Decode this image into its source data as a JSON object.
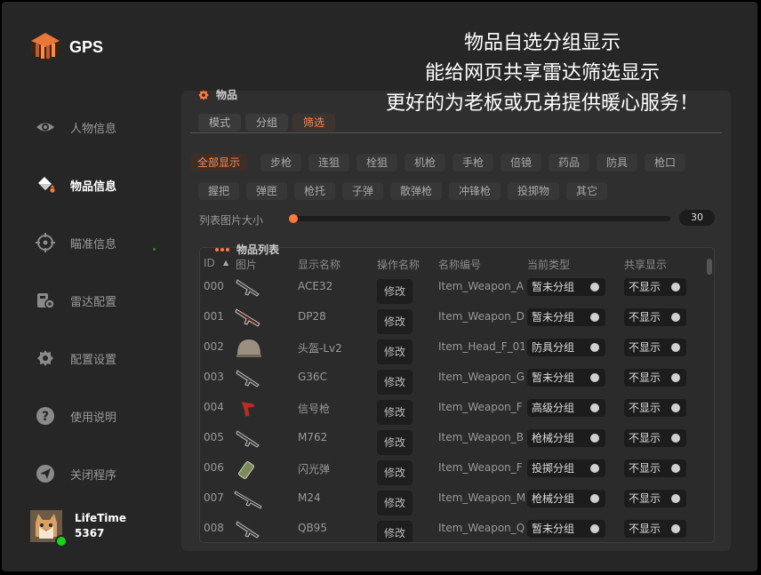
{
  "app": {
    "name": "GPS"
  },
  "overlay_lines": [
    "物品自选分组显示",
    "能给网页共享雷达筛选显示",
    "更好的为老板或兄弟提供暖心服务！"
  ],
  "nav": [
    {
      "label": "人物信息",
      "icon": "eye-icon"
    },
    {
      "label": "物品信息",
      "icon": "paint-bucket-icon"
    },
    {
      "label": "瞄准信息",
      "icon": "crosshair-icon"
    },
    {
      "label": "雷达配置",
      "icon": "radar-config-icon"
    },
    {
      "label": "配置设置",
      "icon": "gear-icon"
    },
    {
      "label": "使用说明",
      "icon": "help-icon"
    },
    {
      "label": "关闭程序",
      "icon": "send-icon"
    }
  ],
  "active_nav": 1,
  "user": {
    "name": "LifeTime",
    "id": "5367",
    "status": "online"
  },
  "panel": {
    "title": "物品",
    "title_icon": "gear-icon"
  },
  "tabs": [
    "模式",
    "分组",
    "筛选"
  ],
  "active_tab": 2,
  "filters": [
    "全部显示",
    "步枪",
    "连狙",
    "栓狙",
    "机枪",
    "手枪",
    "倍镜",
    "药品",
    "防具",
    "枪口",
    "握把",
    "弹匣",
    "枪托",
    "子弹",
    "散弹枪",
    "冲锋枪",
    "投掷物",
    "其它"
  ],
  "active_filter": 0,
  "image_size": {
    "label": "列表图片大小",
    "value": "30",
    "fraction": 0.0
  },
  "list": {
    "title": "物品列表",
    "columns": {
      "id": "ID",
      "pic": "图片",
      "name": "显示名称",
      "op": "操作名称",
      "code": "名称编号",
      "type": "当前类型",
      "share": "共享显示"
    },
    "edit_label": "修改",
    "rows": [
      {
        "id": "000",
        "name": "ACE32",
        "code": "Item_Weapon_A",
        "type": "暂未分组",
        "share": "不显示",
        "icon": "rifle-icon"
      },
      {
        "id": "001",
        "name": "DP28",
        "code": "Item_Weapon_D",
        "type": "暂未分组",
        "share": "不显示",
        "icon": "machine-gun-icon"
      },
      {
        "id": "002",
        "name": "头盔-Lv2",
        "code": "Item_Head_F_01",
        "type": "防具分组",
        "share": "不显示",
        "icon": "helmet-icon"
      },
      {
        "id": "003",
        "name": "G36C",
        "code": "Item_Weapon_G",
        "type": "暂未分组",
        "share": "不显示",
        "icon": "rifle-icon"
      },
      {
        "id": "004",
        "name": "信号枪",
        "code": "Item_Weapon_F",
        "type": "高级分组",
        "share": "不显示",
        "icon": "flare-gun-icon"
      },
      {
        "id": "005",
        "name": "M762",
        "code": "Item_Weapon_B",
        "type": "枪械分组",
        "share": "不显示",
        "icon": "rifle-icon"
      },
      {
        "id": "006",
        "name": "闪光弹",
        "code": "Item_Weapon_F",
        "type": "投掷分组",
        "share": "不显示",
        "icon": "flashbang-icon"
      },
      {
        "id": "007",
        "name": "M24",
        "code": "Item_Weapon_M",
        "type": "枪械分组",
        "share": "不显示",
        "icon": "sniper-rifle-icon"
      },
      {
        "id": "008",
        "name": "QB95",
        "code": "Item_Weapon_Q",
        "type": "暂未分组",
        "share": "不显示",
        "icon": "rifle-icon"
      }
    ]
  },
  "colors": {
    "accent": "#ff7a3a",
    "background": "#262626",
    "panel": "#2f2f2f",
    "online": "#19d219"
  }
}
